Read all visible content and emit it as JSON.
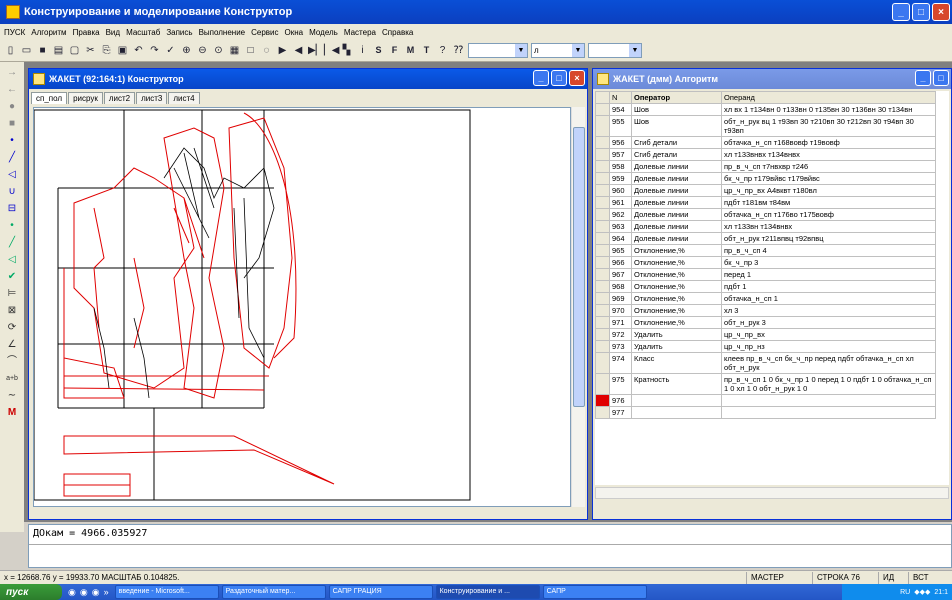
{
  "app": {
    "title": "Конструирование и моделирование  Конструктор"
  },
  "menu": [
    "ПУСК",
    "Алгоритм",
    "Правка",
    "Вид",
    "Масштаб",
    "Запись",
    "Выполнение",
    "Сервис",
    "Окна",
    "Модель",
    "Мастера",
    "Справка"
  ],
  "toolbar": {
    "letters": [
      "S",
      "F",
      "M",
      "T"
    ],
    "combo_value": "л"
  },
  "win1": {
    "title": "ЖАКЕТ (92:164:1) Конструктор",
    "tabs": [
      "сп_пол",
      "рисрук",
      "лист2",
      "лист3",
      "лист4"
    ]
  },
  "win2": {
    "title": "ЖАКЕТ (дмм) Алгоритм",
    "columns": [
      "N",
      "Оператор",
      "Операнд"
    ],
    "rows": [
      [
        "954",
        "Шов",
        "хл вх 1 т134вн 0 т133вн 0 т135вн 30 т136вн 30 т134вн"
      ],
      [
        "955",
        "Шов",
        "обт_н_рук вц 1 т93вп 30 т210вп 30 т212вп 30 т94вп 30 т93вп"
      ],
      [
        "956",
        "Сгиб детали",
        "обтачка_н_сп т168вовф т19вовф"
      ],
      [
        "957",
        "Сгиб детали",
        "хл т133внвх т134внвх"
      ],
      [
        "958",
        "Долевые линии",
        "пр_в_ч_сп т7нвхвр т246"
      ],
      [
        "959",
        "Долевые линии",
        "бк_ч_пр т179вйвс т179вйвс"
      ],
      [
        "960",
        "Долевые линии",
        "цр_ч_пр_вх А4вквт т180вл"
      ],
      [
        "961",
        "Долевые линии",
        "пдбт т181вм т84вм"
      ],
      [
        "962",
        "Долевые линии",
        "обтачка_н_сп т176во т175вовф"
      ],
      [
        "963",
        "Долевые линии",
        "хл т133вн т134внвх"
      ],
      [
        "964",
        "Долевые линии",
        "обт_н_рук т211впвц т92впвц"
      ],
      [
        "965",
        "Отклонение,%",
        "пр_в_ч_сп 4"
      ],
      [
        "966",
        "Отклонение,%",
        "бк_ч_пр 3"
      ],
      [
        "967",
        "Отклонение,%",
        "перед 1"
      ],
      [
        "968",
        "Отклонение,%",
        "пдбт 1"
      ],
      [
        "969",
        "Отклонение,%",
        "обтачка_н_сп 1"
      ],
      [
        "970",
        "Отклонение,%",
        "хл 3"
      ],
      [
        "971",
        "Отклонение,%",
        "обт_н_рук 3"
      ],
      [
        "972",
        "Удалить",
        "цр_ч_пр_вх"
      ],
      [
        "973",
        "Удалить",
        "цр_ч_пр_нз"
      ],
      [
        "974",
        "Класс",
        "клеев пр_в_ч_сп бк_ч_пр перед пдбт обтачка_н_сп хл обт_н_рук"
      ],
      [
        "975",
        "Кратность",
        "пр_в_ч_сп 1 0 бк_ч_пр 1 0 перед 1 0 пдбт 1 0 обтачка_н_сп 1 0 хл 1 0 обт_н_рук 1 0"
      ],
      [
        "976",
        "",
        ""
      ],
      [
        "977",
        "",
        ""
      ]
    ],
    "selected_row": "960"
  },
  "command": "ДОкам = 4966.035927",
  "status": {
    "coords": "x = 12668.76    y = 19933.70 МАСШТАБ 0.104825.",
    "mode": "МАСТЕР",
    "line": "СТРОКА 76",
    "id": "ИД",
    "ins": "ВСТ"
  },
  "taskbar": {
    "start": "пуск",
    "tasks": [
      "введение - Microsoft...",
      "Раздаточный матер...",
      "САПР ГРАЦИЯ",
      "Конструирование и ...",
      "САПР"
    ],
    "active_task": 3,
    "lang": "RU",
    "time": "21:1"
  },
  "colors": {
    "pattern_red": "#e00000",
    "grid": "#000000"
  }
}
